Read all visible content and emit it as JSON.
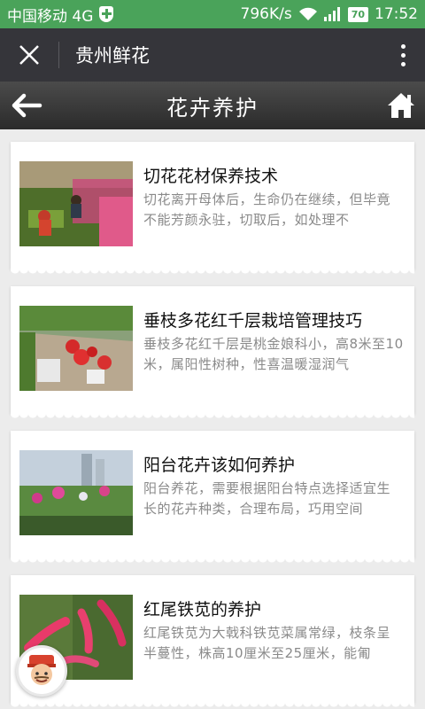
{
  "status_bar": {
    "carrier": "中国移动 4G",
    "speed": "796K/s",
    "battery": "70",
    "time": "17:52"
  },
  "wechat_bar": {
    "close_icon": "close-icon",
    "title": "贵州鲜花",
    "more_icon": "more-vertical-icon"
  },
  "app_bar": {
    "title": "花卉养护",
    "back_icon": "arrow-left-icon",
    "home_icon": "home-icon"
  },
  "articles": [
    {
      "title": "切花花材保养技术",
      "desc": "切花离开母体后，生命仍在继续，但毕竟不能芳颜永驻，切取后，如处理不"
    },
    {
      "title": "垂枝多花红千层栽培管理技巧",
      "desc": "垂枝多花红千层是桃金娘科小，高8米至10米，属阳性树种，性喜温暖湿润气"
    },
    {
      "title": "阳台花卉该如何养护",
      "desc": "阳台养花，需要根据阳台特点选择适宜生长的花卉种类，合理布局，巧用空间"
    },
    {
      "title": "红尾铁苋的养护",
      "desc": "红尾铁苋为大戟科铁苋菜属常绿，枝条呈半蔓性，株高10厘米至25厘米，能匍"
    }
  ],
  "colors": {
    "status_green": "#4aa35a",
    "wechat_dark": "#35353a",
    "appbar_dark": "#2b2b2b"
  }
}
